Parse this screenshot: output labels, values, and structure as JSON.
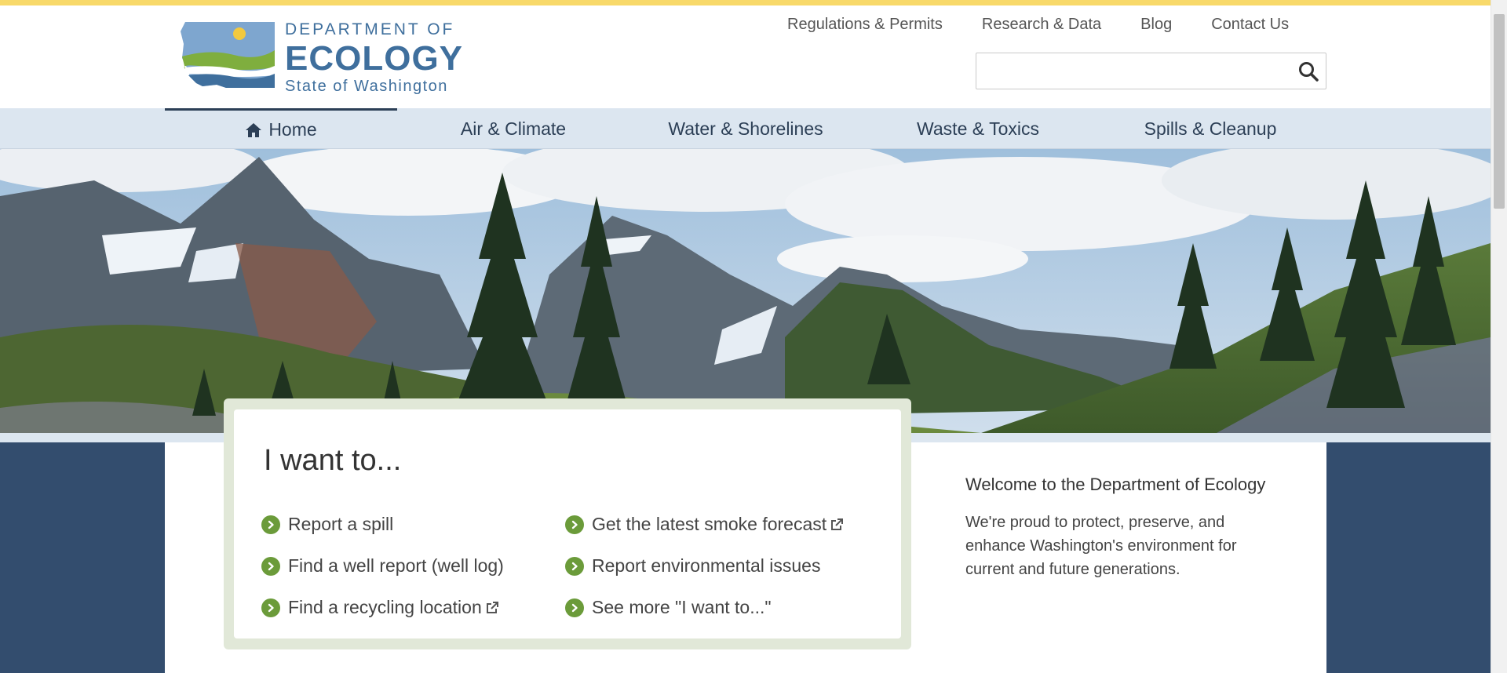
{
  "header": {
    "logo": {
      "line1": "DEPARTMENT OF",
      "line2": "ECOLOGY",
      "line3": "State of Washington"
    },
    "utility_nav": [
      "Regulations & Permits",
      "Research & Data",
      "Blog",
      "Contact Us"
    ],
    "search": {
      "value": "",
      "placeholder": "",
      "icon": "search-icon"
    }
  },
  "main_nav": [
    {
      "label": "Home",
      "icon": "home-icon",
      "active": true
    },
    {
      "label": "Air & Climate"
    },
    {
      "label": "Water & Shorelines"
    },
    {
      "label": "Waste & Toxics"
    },
    {
      "label": "Spills & Cleanup"
    }
  ],
  "hero": {
    "scene": "mountain-meadow-photo"
  },
  "i_want_to": {
    "title": "I want to...",
    "links": [
      {
        "label": "Report a spill",
        "external": false
      },
      {
        "label": "Find a well report (well log)",
        "external": false
      },
      {
        "label": "Find a recycling location",
        "external": true
      },
      {
        "label": "Get the latest smoke forecast",
        "external": true
      },
      {
        "label": "Report environmental issues",
        "external": false
      },
      {
        "label": "See more \"I want to...\"",
        "external": false
      }
    ]
  },
  "welcome": {
    "title": "Welcome to the Department of Ecology",
    "body": "We're proud to protect, preserve, and enhance Washington's environment for current and future generations."
  },
  "colors": {
    "top_stripe": "#f8d96a",
    "nav_bg": "#dce6f0",
    "nav_text": "#2c3f56",
    "side_panels": "#334d6e",
    "link_bullet": "#6b9b3a",
    "card_border": "#e1e8d8",
    "logo_blue": "#3f6f9d"
  }
}
